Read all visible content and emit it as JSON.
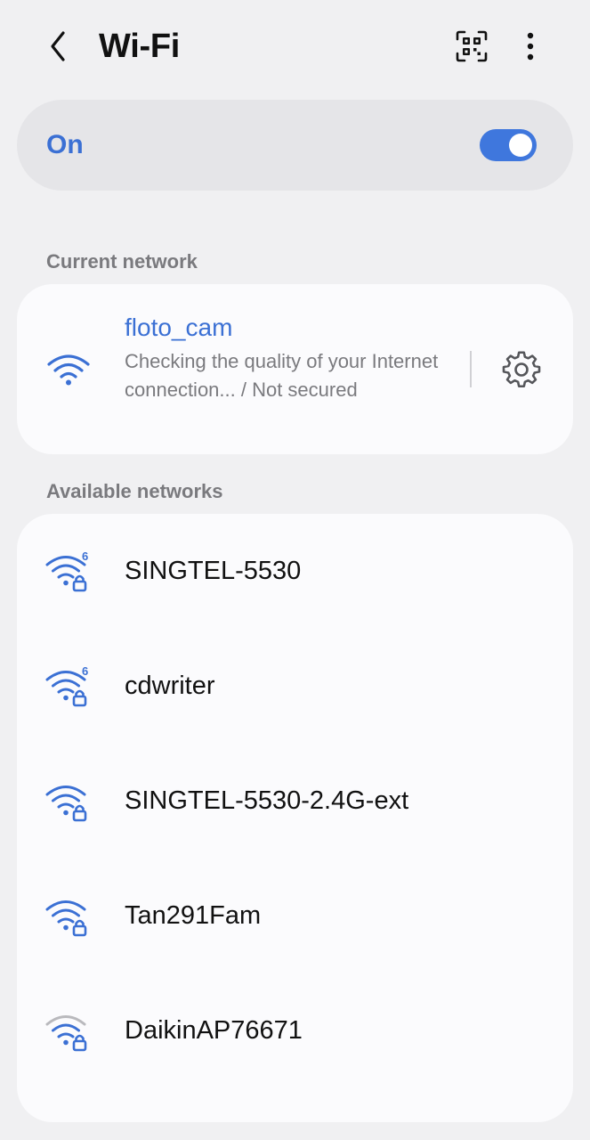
{
  "header": {
    "title": "Wi-Fi"
  },
  "toggle": {
    "label": "On",
    "enabled": true
  },
  "current_section": {
    "label": "Current network"
  },
  "current_network": {
    "ssid": "floto_cam",
    "status": "Checking the quality of your Internet connection... / Not secured"
  },
  "available_section": {
    "label": "Available networks"
  },
  "available_networks": [
    {
      "ssid": "SINGTEL-5530",
      "wifi6": true,
      "secured": true
    },
    {
      "ssid": "cdwriter",
      "wifi6": true,
      "secured": true
    },
    {
      "ssid": "SINGTEL-5530-2.4G-ext",
      "wifi6": false,
      "secured": true
    },
    {
      "ssid": "Tan291Fam",
      "wifi6": false,
      "secured": true
    },
    {
      "ssid": "DaikinAP76671",
      "wifi6": false,
      "secured": true
    }
  ],
  "colors": {
    "accent": "#3b70d4",
    "signal_strong": "#3b70d4",
    "signal_weak": "#b9b9bd",
    "background": "#f0f0f2",
    "card": "#fbfbfd"
  }
}
